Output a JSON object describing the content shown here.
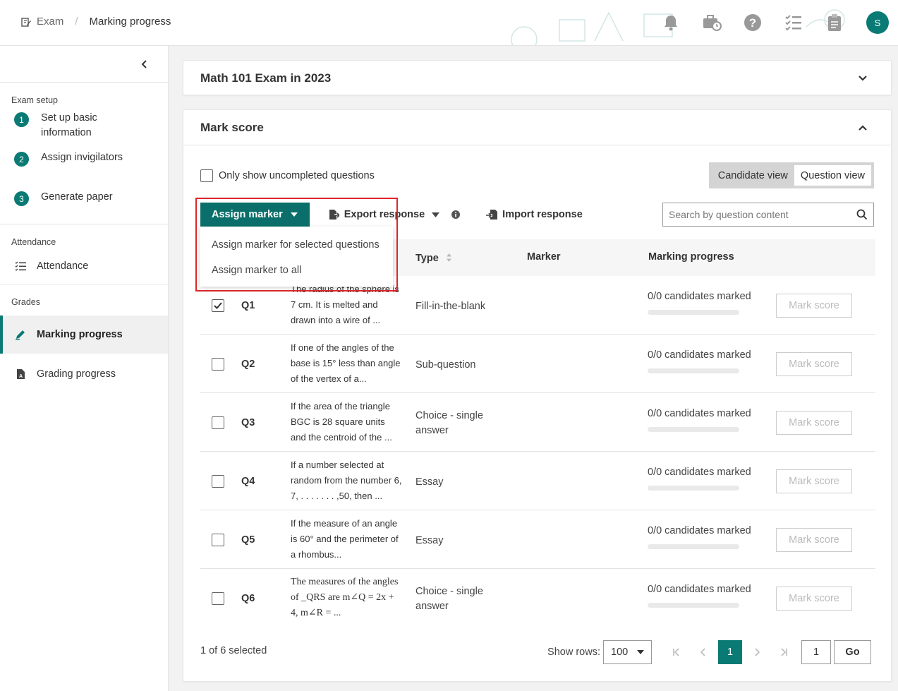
{
  "header": {
    "breadcrumb": {
      "root": "Exam",
      "separator": "/",
      "current": "Marking progress"
    },
    "icons": [
      "bell-icon",
      "briefcase-clock-icon",
      "help-icon",
      "checklist-icon",
      "clipboard-icon"
    ],
    "avatar_initial": "S"
  },
  "sidebar": {
    "sections": {
      "exam_setup": "Exam setup",
      "attendance": "Attendance",
      "grades": "Grades"
    },
    "steps": [
      {
        "num": "1",
        "label": "Set up basic information"
      },
      {
        "num": "2",
        "label": "Assign invigilators"
      },
      {
        "num": "3",
        "label": "Generate paper"
      }
    ],
    "attendance_item": "Attendance",
    "grades_items": [
      "Marking progress",
      "Grading progress"
    ],
    "active_item": "Marking progress"
  },
  "exam_card": {
    "title": "Math 101 Exam in 2023"
  },
  "mark_card": {
    "title": "Mark score",
    "only_uncompleted_label": "Only show uncompleted questions",
    "view_toggle": {
      "candidate": "Candidate view",
      "question": "Question view",
      "selected": "Question view"
    },
    "toolbar": {
      "assign_marker": "Assign marker",
      "export_response": "Export response",
      "import_response": "Import response"
    },
    "search_placeholder": "Search by question content",
    "dropdown": [
      "Assign marker for selected questions",
      "Assign marker to all"
    ],
    "columns": {
      "type": "Type",
      "marker": "Marker",
      "progress": "Marking progress"
    },
    "rows": [
      {
        "id": "Q1",
        "text": "The radius of the sphere is 7 cm. It is melted and drawn into a wire of ...",
        "type": "Fill-in-the-blank",
        "marker": "",
        "progress": "0/0 candidates marked",
        "progress_fraction": 0,
        "action": "Mark score",
        "checked": true
      },
      {
        "id": "Q2",
        "text": "If one of the angles of the base is 15° less than angle of the vertex of a...",
        "type": "Sub-question",
        "marker": "",
        "progress": "0/0 candidates marked",
        "progress_fraction": 0,
        "action": "Mark score",
        "checked": false
      },
      {
        "id": "Q3",
        "text": "If the area of the triangle BGC is 28 square units and the centroid of the ...",
        "type": "Choice - single answer",
        "marker": "",
        "progress": "0/0 candidates marked",
        "progress_fraction": 0,
        "action": "Mark score",
        "checked": false
      },
      {
        "id": "Q4",
        "text": "If a number selected at random from the number 6, 7, . . . . . . . ,50, then ...",
        "type": "Essay",
        "marker": "",
        "progress": "0/0 candidates marked",
        "progress_fraction": 0,
        "action": "Mark score",
        "checked": false
      },
      {
        "id": "Q5",
        "text": "If the measure of an angle is 60° and the perimeter of a rhombus...",
        "type": "Essay",
        "marker": "",
        "progress": "0/0 candidates marked",
        "progress_fraction": 0,
        "action": "Mark score",
        "checked": false
      },
      {
        "id": "Q6",
        "text": "The measures of the angles of _QRS are m∠Q = 2x + 4, m∠R = ...",
        "type": "Choice - single answer",
        "marker": "",
        "progress": "0/0 candidates marked",
        "progress_fraction": 0,
        "action": "Mark score",
        "checked": false
      }
    ],
    "footer": {
      "selected_text": "1 of 6 selected",
      "show_rows_label": "Show rows:",
      "rows_per_page": "100",
      "current_page": "1",
      "page_input": "1",
      "go_label": "Go"
    }
  },
  "colors": {
    "accent": "#0a7a74",
    "highlight": "#e0262a"
  }
}
